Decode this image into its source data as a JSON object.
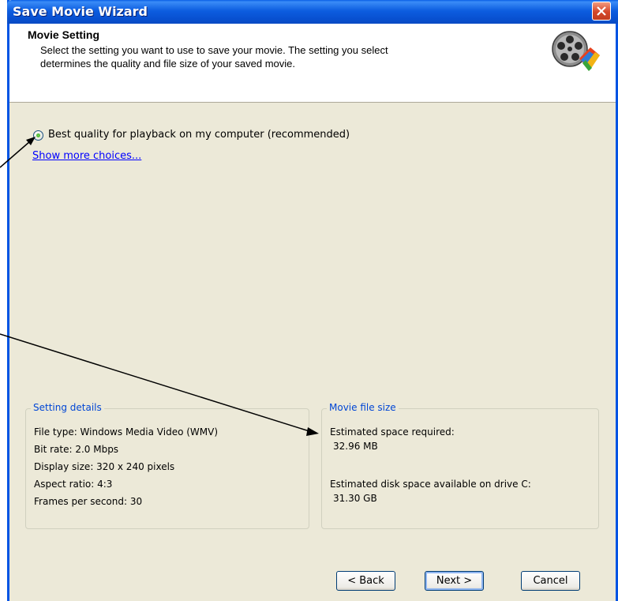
{
  "window": {
    "title": "Save Movie Wizard"
  },
  "header": {
    "title": "Movie Setting",
    "description_line1": "Select the setting you want to use to save your movie. The setting you select",
    "description_line2": "determines the quality and file size of your saved movie.",
    "icon": "movie-reel-icon"
  },
  "options": {
    "radio_label": "Best quality for playback on my computer (recommended)",
    "radio_selected": true,
    "more_link": "Show more choices..."
  },
  "setting_details": {
    "legend": "Setting details",
    "file_type": "File type: Windows Media Video (WMV)",
    "bit_rate": "Bit rate: 2.0 Mbps",
    "display_size": "Display size: 320 x 240 pixels",
    "aspect_ratio": "Aspect ratio: 4:3",
    "fps": "Frames per second: 30"
  },
  "file_size": {
    "legend": "Movie file size",
    "space_required_label": "Estimated space required:",
    "space_required_value": "32.96 MB",
    "disk_available_label": "Estimated disk space available on drive C:",
    "disk_available_value": "31.30 GB"
  },
  "buttons": {
    "back": "< Back",
    "next": "Next >",
    "cancel": "Cancel"
  },
  "colors": {
    "titlebar": "#0a5fe6",
    "dialog_bg": "#ece9d8",
    "groupbox_legend": "#0046d5",
    "link": "#0000ff",
    "close_button": "#d4462a"
  }
}
